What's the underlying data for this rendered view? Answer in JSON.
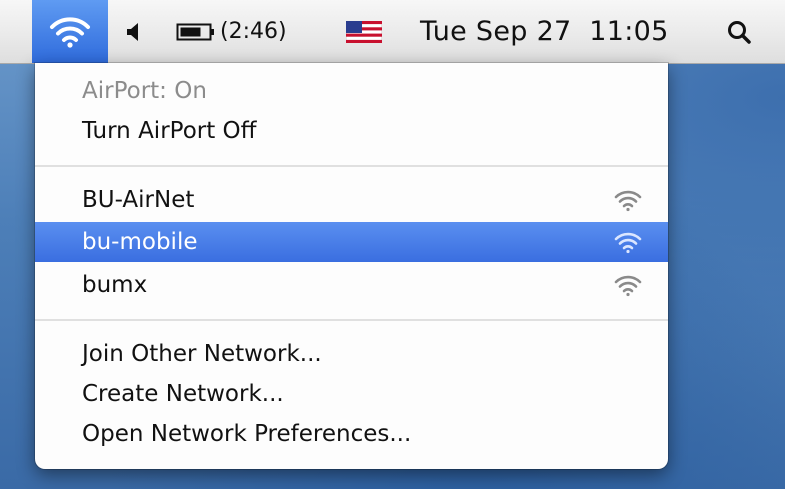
{
  "menubar": {
    "wifi_icon": "wifi-icon",
    "volume_icon": "speaker-icon",
    "battery_icon": "battery-icon",
    "battery_time": "(2:46)",
    "flag_icon": "us-flag-icon",
    "datetime": "Tue Sep 27  11:05",
    "search_icon": "search-icon"
  },
  "menu": {
    "status": "AirPort: On",
    "toggle": "Turn AirPort Off",
    "networks": [
      {
        "name": "BU-AirNet",
        "signal_icon": "wifi-signal-icon"
      },
      {
        "name": "bu-mobile",
        "signal_icon": "wifi-signal-icon",
        "selected": true
      },
      {
        "name": "bumx",
        "signal_icon": "wifi-signal-icon"
      }
    ],
    "join_other": "Join Other Network...",
    "create": "Create Network...",
    "preferences": "Open Network Preferences..."
  },
  "colors": {
    "highlight": "#3a6ee0",
    "menubar_selected": "#2f6bdc",
    "desktop": "#4d7fb8"
  }
}
